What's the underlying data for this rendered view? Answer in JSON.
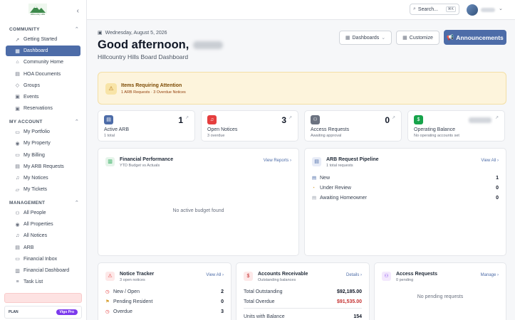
{
  "app": {
    "logo_text": "Hillcountry Hills"
  },
  "sidebar": {
    "sections": [
      {
        "title": "COMMUNITY",
        "items": [
          {
            "label": "Getting Started",
            "icon": "rocket-icon"
          },
          {
            "label": "Dashboard",
            "icon": "grid-icon",
            "active": true
          },
          {
            "label": "Community Home",
            "icon": "home-icon"
          },
          {
            "label": "HOA Documents",
            "icon": "document-icon"
          },
          {
            "label": "Groups",
            "icon": "layers-icon"
          },
          {
            "label": "Events",
            "icon": "calendar-icon"
          },
          {
            "label": "Reservations",
            "icon": "calendar-check-icon"
          }
        ]
      },
      {
        "title": "MY ACCOUNT",
        "items": [
          {
            "label": "My Portfolio",
            "icon": "folder-icon"
          },
          {
            "label": "My Property",
            "icon": "map-pin-icon"
          },
          {
            "label": "My Billing",
            "icon": "credit-card-icon"
          },
          {
            "label": "My ARB Requests",
            "icon": "clipboard-icon"
          },
          {
            "label": "My Notices",
            "icon": "bell-icon"
          },
          {
            "label": "My Tickets",
            "icon": "ticket-icon"
          }
        ]
      },
      {
        "title": "MANAGEMENT",
        "items": [
          {
            "label": "All People",
            "icon": "users-icon"
          },
          {
            "label": "All Properties",
            "icon": "map-pin-icon"
          },
          {
            "label": "All Notices",
            "icon": "bell-icon"
          },
          {
            "label": "ARB",
            "icon": "clipboard-icon"
          },
          {
            "label": "Financial Inbox",
            "icon": "inbox-icon"
          },
          {
            "label": "Financial Dashboard",
            "icon": "chart-icon"
          },
          {
            "label": "Task List",
            "icon": "list-icon"
          }
        ]
      }
    ],
    "plan_label": "PLAN",
    "plan_badge": "Vigo Pro"
  },
  "topbar": {
    "search_placeholder": "Search...",
    "search_shortcut": "⌘K"
  },
  "header": {
    "date": "Wednesday, August 5, 2026",
    "greeting": "Good afternoon,",
    "subtitle": "Hillcountry Hills Board Dashboard",
    "dashboards_button": "Dashboards",
    "customize_button": "Customize",
    "announcements_button": "Announcements"
  },
  "alert": {
    "title": "Items Requiring Attention",
    "subtitle": "1 ARB Requests · 3 Overdue Notices"
  },
  "stats": [
    {
      "label": "Active ARB",
      "sub": "1 total",
      "value": "1",
      "color": "#4d6ca8",
      "icon": "document-icon"
    },
    {
      "label": "Open Notices",
      "sub": "3 overdue",
      "value": "3",
      "color": "#e53e3e",
      "icon": "bell-icon"
    },
    {
      "label": "Access Requests",
      "sub": "Awaiting approval",
      "value": "0",
      "color": "#6b7280",
      "icon": "user-plus-icon"
    },
    {
      "label": "Operating Balance",
      "sub": "No operating accounts set",
      "value": "",
      "color": "#16a34a",
      "icon": "dollar-icon"
    }
  ],
  "financial_performance": {
    "title": "Financial Performance",
    "subtitle": "YTD Budget vs Actuals",
    "link": "View Reports",
    "empty": "No active budget found"
  },
  "arb_pipeline": {
    "title": "ARB Request Pipeline",
    "subtitle": "1 total requests",
    "link": "View All",
    "rows": [
      {
        "label": "New",
        "value": "1",
        "color": "#4d6ca8"
      },
      {
        "label": "Under Review",
        "value": "0",
        "color": "#d69e2e"
      },
      {
        "label": "Awaiting Homeowner",
        "value": "0",
        "color": "#9ca3af"
      }
    ]
  },
  "notice_tracker": {
    "title": "Notice Tracker",
    "subtitle": "3 open notices",
    "link": "View All",
    "rows": [
      {
        "label": "New / Open",
        "value": "2",
        "color": "#e53e3e"
      },
      {
        "label": "Pending Resident",
        "value": "0",
        "color": "#d69e2e"
      },
      {
        "label": "Overdue",
        "value": "3",
        "color": "#e53e3e"
      }
    ]
  },
  "accounts_receivable": {
    "title": "Accounts Receivable",
    "subtitle": "Outstanding balances",
    "link": "Details",
    "rows": [
      {
        "label": "Total Outstanding",
        "value": "$92,185.00",
        "color": "#111827"
      },
      {
        "label": "Total Overdue",
        "value": "$91,535.00",
        "color": "#c53030"
      },
      {
        "label": "Units with Balance",
        "value": "154",
        "color": "#111827"
      }
    ]
  },
  "access_requests": {
    "title": "Access Requests",
    "subtitle": "0 pending",
    "link": "Manage",
    "empty": "No pending requests"
  }
}
